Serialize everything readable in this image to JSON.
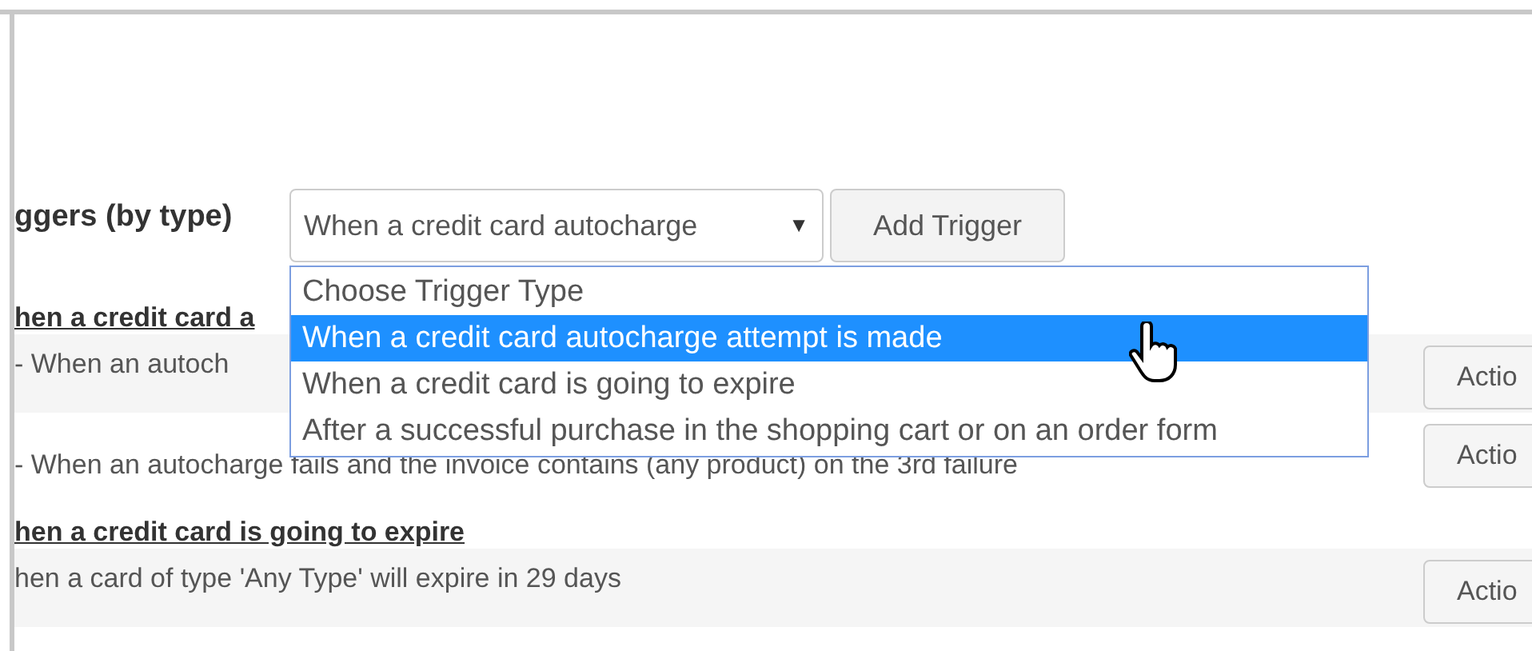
{
  "trigger_label": "ggers (by type)",
  "select": {
    "value": "When a credit card autocharge",
    "expanded": true,
    "caret": "▼"
  },
  "add_button": "Add Trigger",
  "dropdown": [
    {
      "label": "Choose Trigger Type",
      "selected": false
    },
    {
      "label": "When a credit card autocharge attempt is made",
      "selected": true
    },
    {
      "label": "When a credit card is going to expire",
      "selected": false
    },
    {
      "label": "After a successful purchase in the shopping cart or on an order form",
      "selected": false
    }
  ],
  "sections": [
    {
      "heading": "hen a credit card a",
      "rows": [
        {
          "text": "- When an autoch",
          "action": "Actio"
        },
        {
          "text": "- When an autocharge fails and the invoice contains (any product) on the 3rd failure",
          "action": "Actio"
        }
      ]
    },
    {
      "heading": "hen a credit card is going to expire",
      "rows": [
        {
          "text": "hen a card of type 'Any Type' will expire in 29 days",
          "action": "Actio"
        }
      ]
    }
  ]
}
